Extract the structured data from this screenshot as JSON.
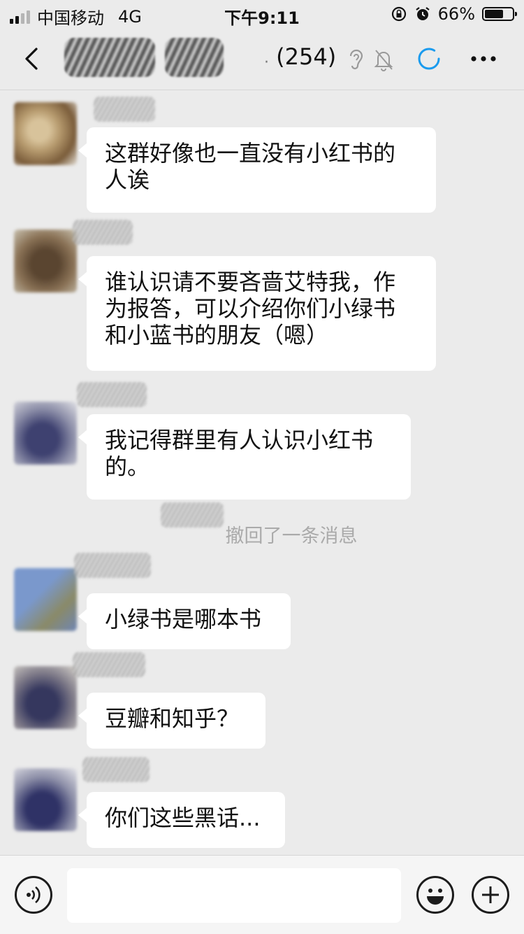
{
  "status_bar": {
    "carrier": "中国移动",
    "network": "4G",
    "time": "下午9:11",
    "battery": "66%",
    "battery_level": 0.66
  },
  "nav": {
    "member_count": "(254)",
    "icons": [
      "back-arrow-icon",
      "ear-icon",
      "bell-muted-icon",
      "refresh-icon",
      "more-icon"
    ]
  },
  "messages": [
    {
      "lines": [
        "这群好像也一直没有小红书的",
        "人诶"
      ]
    },
    {
      "lines": [
        "谁认识请不要吝啬艾特我，作",
        "为报答，可以介绍你们小绿书",
        "和小蓝书的朋友（嗯）"
      ]
    },
    {
      "lines": [
        "我记得群里有人认识小红书",
        "的。"
      ]
    },
    {
      "lines": [
        "小绿书是哪本书"
      ]
    },
    {
      "lines": [
        "豆瓣和知乎？"
      ]
    },
    {
      "lines": [
        "你们这些黑话..."
      ]
    }
  ],
  "system": {
    "recall": "撤回了一条消息"
  },
  "input": {
    "icons": [
      "voice-icon",
      "emoji-icon",
      "plus-icon"
    ]
  },
  "colors": {
    "accent": "#1a9bee",
    "bubble": "#ffffff",
    "background": "#ebebeb"
  }
}
